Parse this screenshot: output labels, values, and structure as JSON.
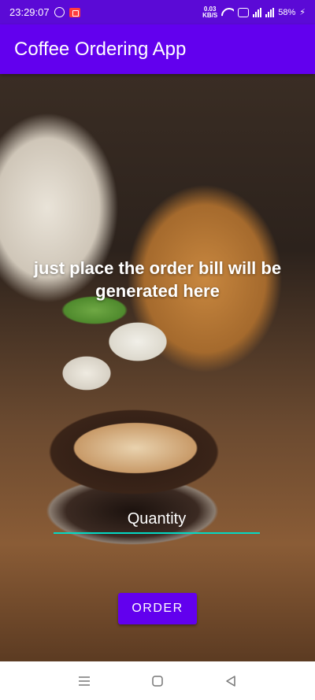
{
  "status_bar": {
    "time": "23:29:07",
    "speed_value": "0.03",
    "speed_unit": "KB/S",
    "battery": "58%"
  },
  "app_bar": {
    "title": "Coffee Ordering App"
  },
  "main": {
    "headline": "just place the order bill will be generated here",
    "quantity_placeholder": "Quantity",
    "order_label": "ORDER"
  },
  "nav_bar": {
    "icons": [
      "menu-icon",
      "home-square-icon",
      "back-triangle-icon"
    ]
  },
  "colors": {
    "status_bar": "#5b0ad6",
    "primary": "#6200ee",
    "accent": "#03dac5"
  }
}
